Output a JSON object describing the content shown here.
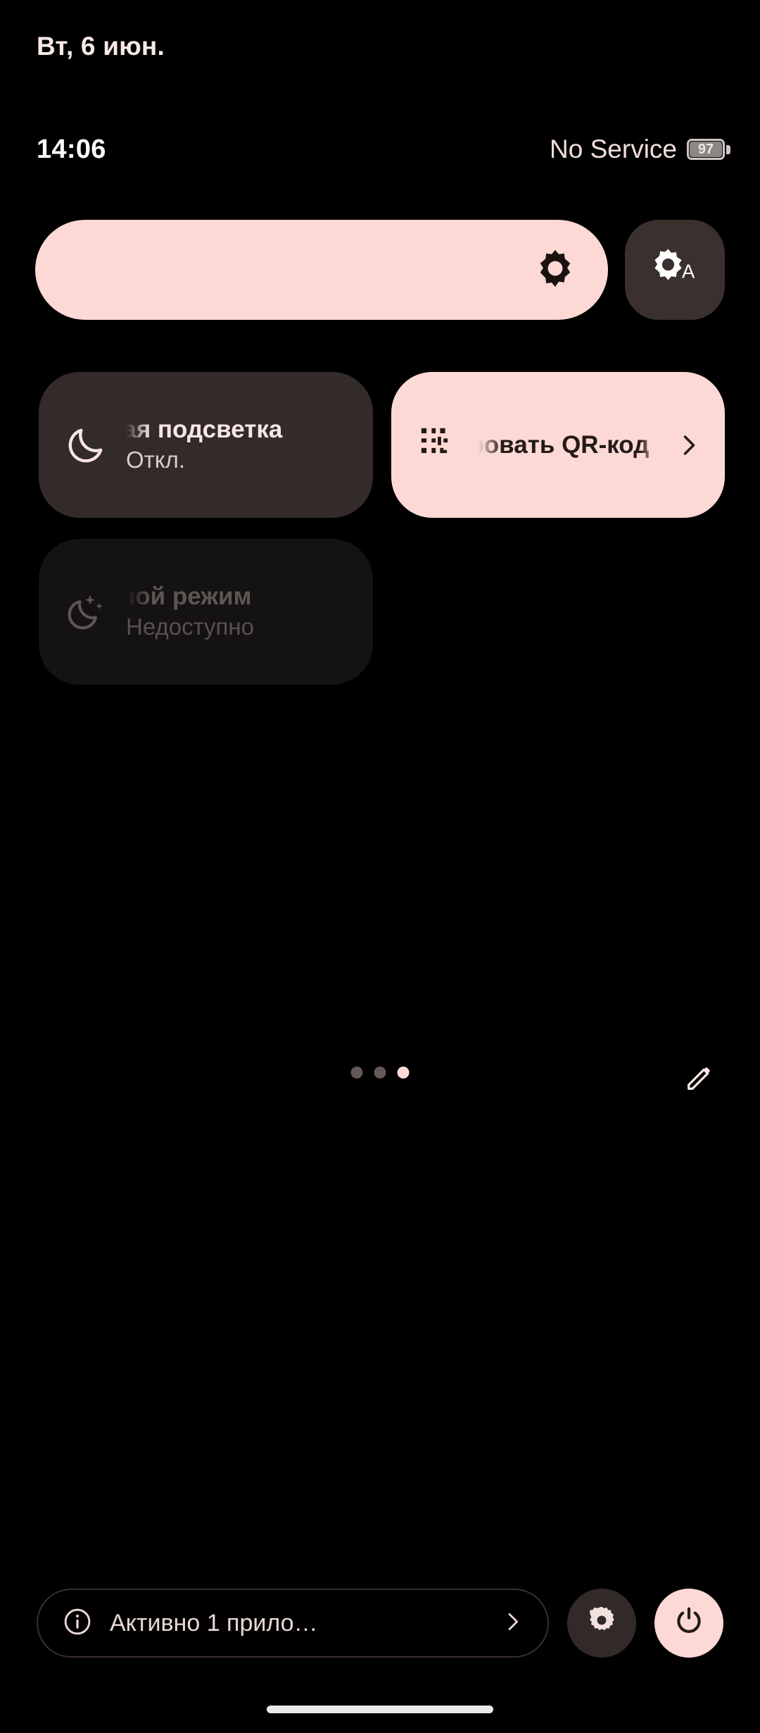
{
  "statusbar": {
    "date": "Вт, 6 июн.",
    "time": "14:06",
    "carrier": "No Service",
    "battery_level": "97",
    "battery_icon": "battery-icon"
  },
  "brightness": {
    "slider_icon": "brightness-sun-icon",
    "value_percent": 100,
    "auto_button_icon": "auto-brightness-icon",
    "auto_label": "A"
  },
  "tiles": [
    {
      "name": "night-light",
      "title": "ная подсветка",
      "full_title": "Ночная подсветка",
      "subtitle": "Откл.",
      "state": "inactive",
      "icon": "moon-icon",
      "has_chevron": false
    },
    {
      "name": "scan-qr",
      "title": "нировать Q",
      "full_title": "Сканировать QR-код",
      "subtitle": "",
      "state": "active",
      "icon": "qr-code-icon",
      "has_chevron": true
    },
    {
      "name": "bedtime-mode",
      "title": "ной режим",
      "full_title": "Ночной режим",
      "subtitle": "Недоступно",
      "state": "disabled",
      "icon": "moon-stars-icon",
      "has_chevron": false
    }
  ],
  "pager": {
    "total_pages": 3,
    "current_page": 3,
    "edit_icon": "edit-pencil-icon"
  },
  "footer": {
    "apps_label": "Активно 1 прило…",
    "info_icon": "info-icon",
    "chevron_icon": "chevron-right-icon",
    "settings_icon": "gear-icon",
    "power_icon": "power-icon"
  },
  "colors": {
    "background": "#000000",
    "accent_pink": "#fcd9d4",
    "tile_inactive": "#332b29",
    "tile_disabled": "#141212",
    "text_light": "#f7e7e4"
  }
}
